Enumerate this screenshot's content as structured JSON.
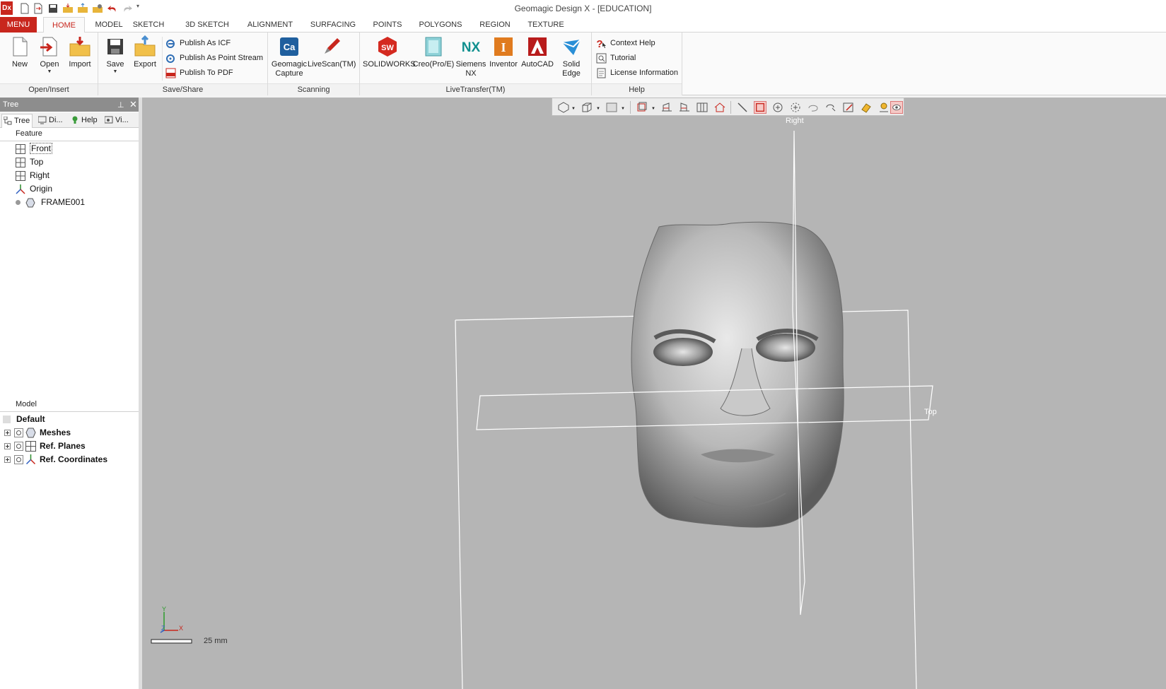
{
  "window": {
    "title": "Geomagic Design X - [EDUCATION]",
    "logo": "Dx"
  },
  "tabs": [
    "MENU",
    "HOME",
    "MODEL",
    "SKETCH",
    "3D SKETCH",
    "ALIGNMENT",
    "SURFACING",
    "POINTS",
    "POLYGONS",
    "REGION",
    "TEXTURE"
  ],
  "ribbon": {
    "open_insert": {
      "label": "Open/Insert",
      "new": "New",
      "open": "Open",
      "import": "Import"
    },
    "save_share": {
      "label": "Save/Share",
      "save": "Save",
      "export": "Export",
      "publish_icf": "Publish As ICF",
      "publish_point": "Publish As Point Stream",
      "publish_pdf": "Publish To PDF"
    },
    "scanning": {
      "label": "Scanning",
      "capture_1": "Geomagic",
      "capture_2": "Capture",
      "livescan": "LiveScan(TM)"
    },
    "livetransfer": {
      "label": "LiveTransfer(TM)",
      "solidworks": "SOLIDWORKS",
      "creo": "Creo(Pro/E)",
      "nx_1": "Siemens",
      "nx_2": "NX",
      "inventor": "Inventor",
      "autocad": "AutoCAD",
      "solidedge_1": "Solid",
      "solidedge_2": "Edge"
    },
    "help": {
      "label": "Help",
      "context": "Context Help",
      "tutorial": "Tutorial",
      "license": "License Information"
    }
  },
  "panel": {
    "title": "Tree",
    "tabs": [
      "Tree",
      "Di...",
      "Help",
      "Vi..."
    ],
    "feature_header": "Feature",
    "features": [
      "Front",
      "Top",
      "Right",
      "Origin",
      "FRAME001"
    ],
    "model_header": "Model",
    "model_items": [
      "Default",
      "Meshes",
      "Ref. Planes",
      "Ref. Coordinates"
    ]
  },
  "viewport": {
    "plane_right": "Right",
    "plane_top": "Top",
    "scale": "25 mm",
    "axis_x": "X",
    "axis_y": "Y",
    "axis_z": "Z"
  },
  "colors": {
    "accent": "#c8261d",
    "viewport_bg": "#b5b5b5",
    "mesh": "#a9a9a9"
  }
}
